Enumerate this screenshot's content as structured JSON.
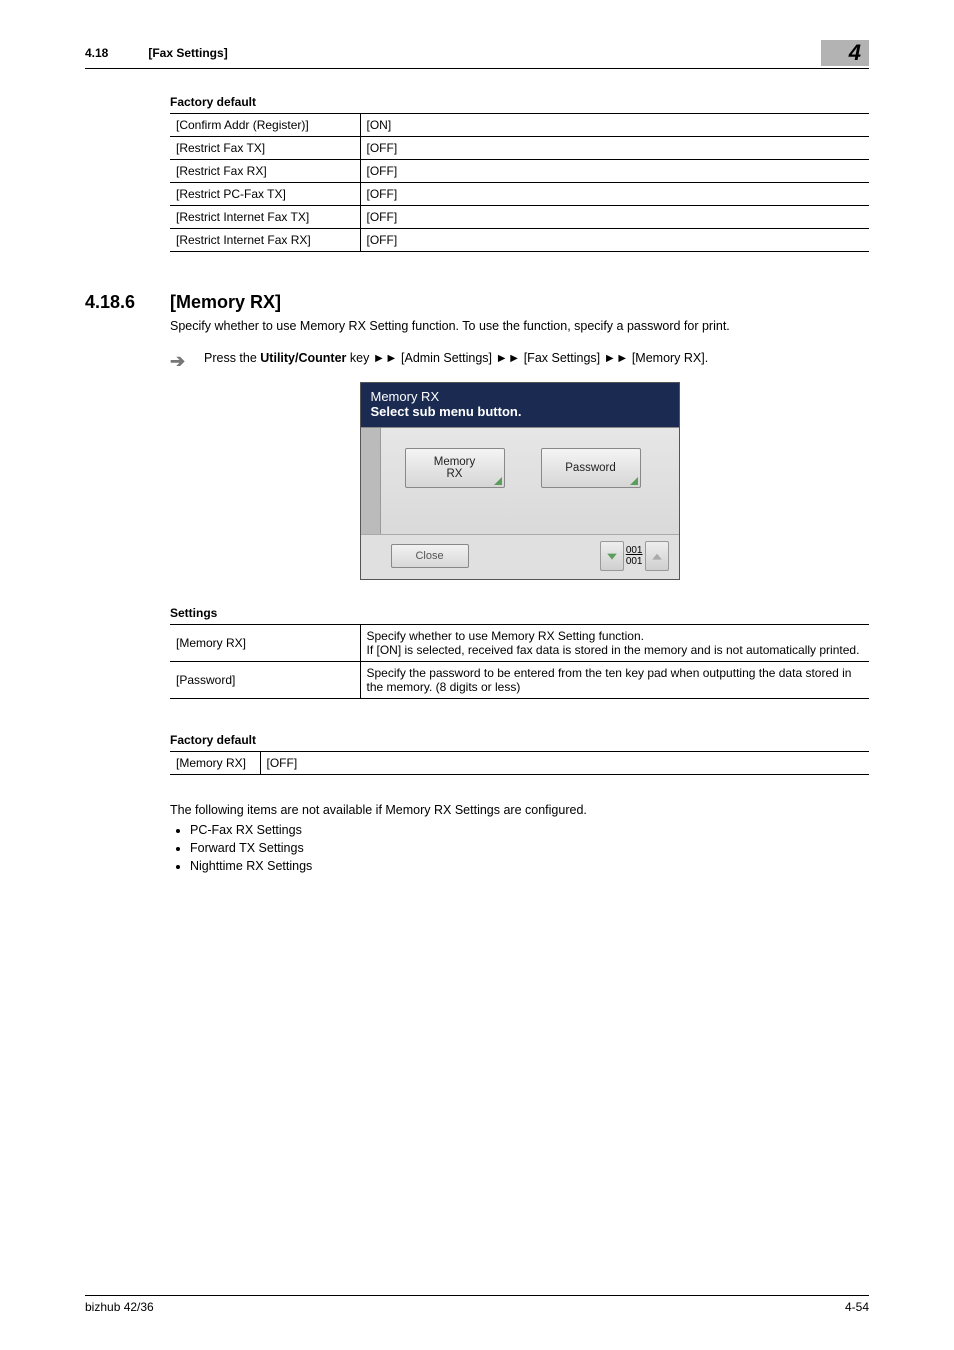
{
  "header": {
    "section_num": "4.18",
    "section_title": "[Fax Settings]",
    "chapter_num": "4"
  },
  "table1": {
    "title": "Factory default",
    "rows": [
      {
        "k": "[Confirm Addr (Register)]",
        "v": "[ON]"
      },
      {
        "k": "[Restrict Fax TX]",
        "v": "[OFF]"
      },
      {
        "k": "[Restrict Fax RX]",
        "v": "[OFF]"
      },
      {
        "k": "[Restrict PC-Fax TX]",
        "v": "[OFF]"
      },
      {
        "k": "[Restrict Internet Fax TX]",
        "v": "[OFF]"
      },
      {
        "k": "[Restrict Internet Fax RX]",
        "v": "[OFF]"
      }
    ]
  },
  "section": {
    "num": "4.18.6",
    "title": "[Memory RX]",
    "para": "Specify whether to use Memory RX Setting function. To use the function, specify a password for print.",
    "step_prefix": "Press the ",
    "step_bold": "Utility/Counter",
    "step_suffix": " key ►► [Admin Settings] ►► [Fax Settings] ►► [Memory RX]."
  },
  "screenshot": {
    "line1": "Memory RX",
    "line2": "Select sub menu button.",
    "btn1a": "Memory",
    "btn1b": "RX",
    "btn2": "Password",
    "close": "Close",
    "page_top": "001",
    "page_bot": "001"
  },
  "table2": {
    "title": "Settings",
    "rows": [
      {
        "k": "[Memory RX]",
        "v": "Specify whether to use Memory RX Setting function.\nIf [ON] is selected, received fax data is stored in the memory and is not automatically printed."
      },
      {
        "k": "[Password]",
        "v": "Specify the password to be entered from the ten key pad when outputting the data stored in the memory. (8 digits or less)"
      }
    ]
  },
  "table3": {
    "title": "Factory default",
    "rows": [
      {
        "k": "[Memory RX]",
        "v": "[OFF]"
      }
    ]
  },
  "note": "The following items are not available if Memory RX Settings are configured.",
  "bullets": [
    "PC-Fax RX Settings",
    "Forward TX Settings",
    "Nighttime RX Settings"
  ],
  "footer": {
    "left": "bizhub 42/36",
    "right": "4-54"
  }
}
